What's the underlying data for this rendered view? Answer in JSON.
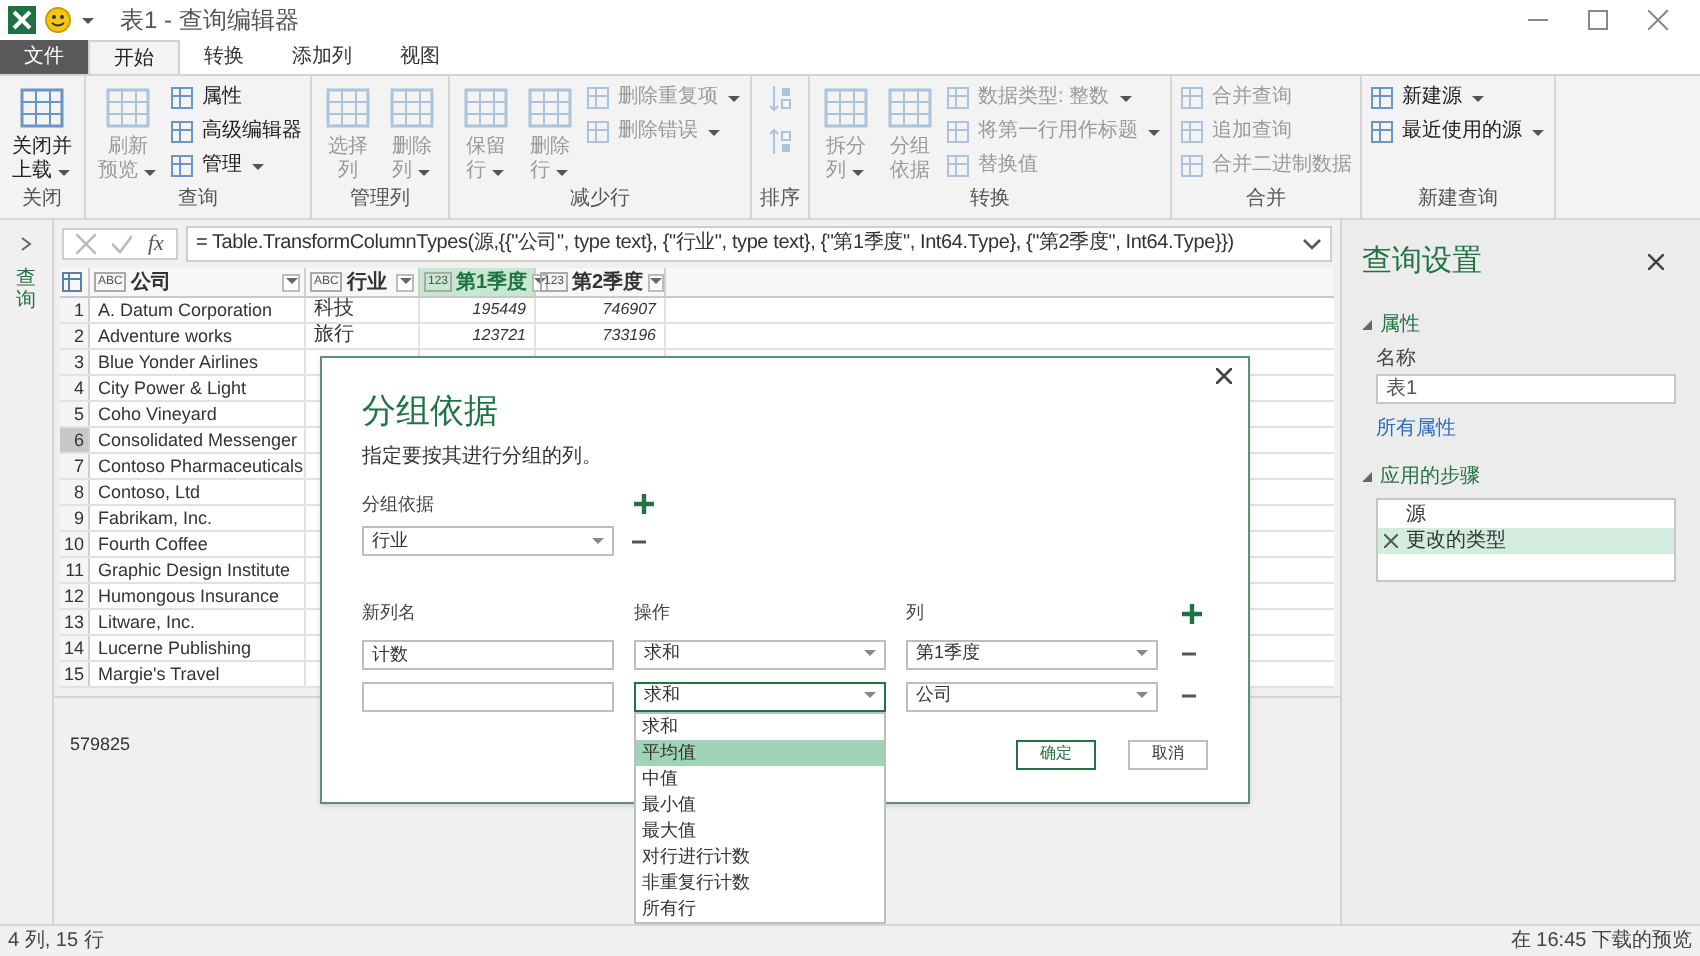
{
  "title_bar": {
    "title": "表1 - 查询编辑器"
  },
  "tabs": [
    {
      "label": "文件",
      "kind": "file",
      "selected": false
    },
    {
      "label": "开始",
      "kind": "tab",
      "selected": true
    },
    {
      "label": "转换",
      "kind": "tab",
      "selected": false
    },
    {
      "label": "添加列",
      "kind": "tab",
      "selected": false
    },
    {
      "label": "视图",
      "kind": "tab",
      "selected": false
    }
  ],
  "ribbon": {
    "groups": [
      {
        "label": "关闭",
        "items": [
          {
            "kind": "large",
            "lines": [
              "关闭并",
              "上载"
            ],
            "menu": true,
            "disabled": false
          }
        ]
      },
      {
        "label": "查询",
        "items": [
          {
            "kind": "large",
            "lines": [
              "刷新",
              "预览"
            ],
            "menu": true,
            "disabled": true
          },
          {
            "kind": "small",
            "lines": [
              "属性"
            ],
            "menu": false,
            "disabled": false
          },
          {
            "kind": "small",
            "lines": [
              "高级编辑器"
            ],
            "menu": false,
            "disabled": false
          },
          {
            "kind": "small",
            "lines": [
              "管理"
            ],
            "menu": true,
            "disabled": false
          }
        ]
      },
      {
        "label": "管理列",
        "items": [
          {
            "kind": "large",
            "lines": [
              "选择",
              "列"
            ],
            "menu": false,
            "disabled": true
          },
          {
            "kind": "large",
            "lines": [
              "删除",
              "列"
            ],
            "menu": true,
            "disabled": true
          }
        ]
      },
      {
        "label": "减少行",
        "items": [
          {
            "kind": "large",
            "lines": [
              "保留",
              "行"
            ],
            "menu": true,
            "disabled": true
          },
          {
            "kind": "large",
            "lines": [
              "删除",
              "行"
            ],
            "menu": true,
            "disabled": true
          },
          {
            "kind": "small",
            "lines": [
              "删除重复项"
            ],
            "menu": true,
            "disabled": true
          },
          {
            "kind": "small",
            "lines": [
              "删除错误"
            ],
            "menu": true,
            "disabled": true
          }
        ]
      },
      {
        "label": "排序",
        "items": [
          {
            "kind": "sort",
            "disabled": true
          }
        ]
      },
      {
        "label": "转换",
        "items": [
          {
            "kind": "large",
            "lines": [
              "拆分",
              "列"
            ],
            "menu": true,
            "disabled": true
          },
          {
            "kind": "large",
            "lines": [
              "分组",
              "依据"
            ],
            "menu": false,
            "disabled": true
          },
          {
            "kind": "small",
            "lines": [
              "数据类型: 整数"
            ],
            "menu": true,
            "disabled": true
          },
          {
            "kind": "small",
            "lines": [
              "将第一行用作标题"
            ],
            "menu": true,
            "disabled": true
          },
          {
            "kind": "small",
            "lines": [
              "替换值"
            ],
            "menu": false,
            "disabled": true
          }
        ]
      },
      {
        "label": "合并",
        "items": [
          {
            "kind": "small",
            "lines": [
              "合并查询"
            ],
            "menu": false,
            "disabled": true
          },
          {
            "kind": "small",
            "lines": [
              "追加查询"
            ],
            "menu": false,
            "disabled": true
          },
          {
            "kind": "small",
            "lines": [
              "合并二进制数据"
            ],
            "menu": false,
            "disabled": true
          }
        ]
      },
      {
        "label": "新建查询",
        "items": [
          {
            "kind": "small",
            "lines": [
              "新建源"
            ],
            "menu": true,
            "disabled": false
          },
          {
            "kind": "small",
            "lines": [
              "最近使用的源"
            ],
            "menu": true,
            "disabled": false
          }
        ]
      }
    ]
  },
  "nav": {
    "label": "查询"
  },
  "fx_label": "fx",
  "formula": "= Table.TransformColumnTypes(源,{{\"公司\", type text}, {\"行业\", type text}, {\"第1季度\", Int64.Type}, {\"第2季度\", Int64.Type}})",
  "table": {
    "columns": [
      {
        "type_label": "ABC",
        "name": "公司",
        "selected": false
      },
      {
        "type_label": "ABC",
        "name": "行业",
        "selected": false
      },
      {
        "type_label": "123",
        "name": "第1季度",
        "selected": true
      },
      {
        "type_label": "123",
        "name": "第2季度",
        "selected": false
      }
    ],
    "rows": [
      {
        "number": "1",
        "selected": false,
        "cells": [
          "A. Datum Corporation",
          "科技",
          "195449",
          "746907"
        ]
      },
      {
        "number": "2",
        "selected": false,
        "cells": [
          "Adventure works",
          "旅行",
          "123721",
          "733196"
        ]
      },
      {
        "number": "3",
        "selected": false,
        "cells": [
          "Blue Yonder Airlines"
        ]
      },
      {
        "number": "4",
        "selected": false,
        "cells": [
          "City Power & Light"
        ]
      },
      {
        "number": "5",
        "selected": false,
        "cells": [
          "Coho Vineyard"
        ]
      },
      {
        "number": "6",
        "selected": true,
        "cells": [
          "Consolidated Messenger"
        ]
      },
      {
        "number": "7",
        "selected": false,
        "cells": [
          "Contoso Pharmaceuticals"
        ]
      },
      {
        "number": "8",
        "selected": false,
        "cells": [
          "Contoso, Ltd"
        ]
      },
      {
        "number": "9",
        "selected": false,
        "cells": [
          "Fabrikam, Inc."
        ]
      },
      {
        "number": "10",
        "selected": false,
        "cells": [
          "Fourth Coffee"
        ]
      },
      {
        "number": "11",
        "selected": false,
        "cells": [
          "Graphic Design Institute"
        ]
      },
      {
        "number": "12",
        "selected": false,
        "cells": [
          "Humongous Insurance"
        ]
      },
      {
        "number": "13",
        "selected": false,
        "cells": [
          "Litware, Inc."
        ]
      },
      {
        "number": "14",
        "selected": false,
        "cells": [
          "Lucerne Publishing"
        ]
      },
      {
        "number": "15",
        "selected": false,
        "cells": [
          "Margie's Travel"
        ]
      }
    ]
  },
  "preview_value": "579825",
  "query_settings": {
    "title": "查询设置",
    "properties_heading": "属性",
    "name_label": "名称",
    "name_value": "表1",
    "all_properties_link": "所有属性",
    "steps_heading": "应用的步骤",
    "steps": [
      {
        "label": "源",
        "selected": false
      },
      {
        "label": "更改的类型",
        "selected": true
      }
    ]
  },
  "dialog": {
    "title": "分组依据",
    "subtitle": "指定要按其进行分组的列。",
    "group_by_label": "分组依据",
    "group_by_value": "行业",
    "headers": [
      "新列名",
      "操作",
      "列"
    ],
    "aggregations": [
      {
        "name": "计数",
        "operation": "求和",
        "column": "第1季度",
        "open": false
      },
      {
        "operation": "求和",
        "column": "公司",
        "open": true
      }
    ],
    "options": [
      {
        "label": "求和",
        "selected": false
      },
      {
        "label": "平均值",
        "selected": true
      },
      {
        "label": "中值",
        "selected": false
      },
      {
        "label": "最小值",
        "selected": false
      },
      {
        "label": "最大值",
        "selected": false
      },
      {
        "label": "对行进行计数",
        "selected": false
      },
      {
        "label": "非重复行计数",
        "selected": false
      },
      {
        "label": "所有行",
        "selected": false
      }
    ],
    "buttons": [
      {
        "label": "确定",
        "primary": true
      },
      {
        "label": "取消",
        "primary": false
      }
    ]
  },
  "status_bar": {
    "left": "4 列, 15 行",
    "right": "在 16:45 下载的预览"
  }
}
